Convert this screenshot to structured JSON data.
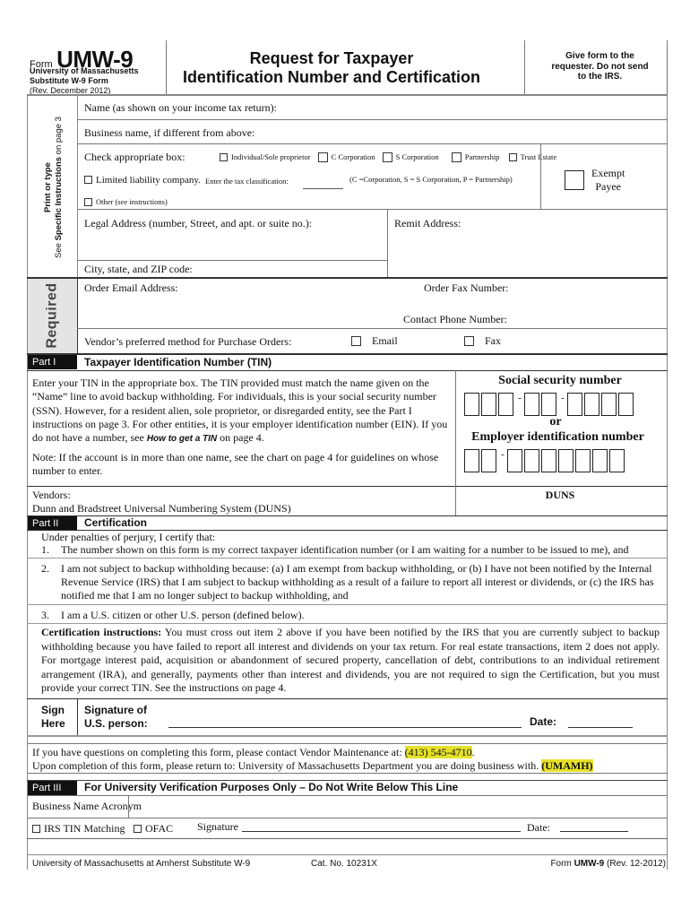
{
  "header": {
    "form_word": "Form",
    "form_code": "UMW-9",
    "org_line1": "University of Massachusetts",
    "org_line2": "Substitute W-9 Form",
    "revision": "(Rev. December 2012)",
    "title_line1": "Request for Taxpayer",
    "title_line2": "Identification Number and Certification",
    "notice": "Give form to the requester.  Do not send to the IRS."
  },
  "side_labels": {
    "print_or_type": "Print or type",
    "see_instructions_pre": "See ",
    "see_instructions_bold": "Specific Instructions",
    "see_instructions_post": " on page 3",
    "required": "Required"
  },
  "identity": {
    "name_label": "Name (as shown on your income tax return):",
    "business_name_label": "Business name, if different from above:",
    "check_box_label": "Check appropriate box:",
    "classifications": [
      "Individual/Sole proprietor",
      "C Corporation",
      "S Corporation",
      "Partnership",
      "Trust Estate"
    ],
    "llc_label": "Limited liability company.",
    "tax_class_label": "Enter the tax classification:",
    "tax_class_legend": "(C =Corporation, S = S Corporation, P = Partnership)",
    "other_label": "Other (see instructions)",
    "exempt_payee_line1": "Exempt",
    "exempt_payee_line2": "Payee",
    "legal_address_label": "Legal Address (number, Street, and apt. or suite no.):",
    "remit_address_label": "Remit Address:",
    "city_state_zip_label": "City, state, and ZIP code:"
  },
  "required_section": {
    "order_email_label": "Order Email Address:",
    "order_fax_label": "Order Fax Number:",
    "contact_phone_label": "Contact Phone Number:",
    "preferred_method_label": "Vendor’s preferred method for Purchase Orders:",
    "option_email": "Email",
    "option_fax": "Fax"
  },
  "part1": {
    "part_label": "Part I",
    "title": "Taxpayer Identification Number (TIN)",
    "instructions_pre": "Enter your TIN in the appropriate box.  The TIN provided must match the name given on the “Name” line to avoid backup withholding.  For individuals, this is your social security number (SSN).  However, for a resident alien, sole proprietor, or disregarded entity, see the Part I instructions on page 3.  For other entities, it is your employer identification number (EIN).  If you do not have a number, see ",
    "instructions_link": "How to get a TIN",
    "instructions_post": " on page 4.",
    "note": "Note: If the account is in more than one name, see the chart on page 4 for guidelines on whose number to enter.",
    "ssn_label": "Social security number",
    "or_label": "or",
    "ein_label": "Employer identification number",
    "vendors_label": "Vendors:",
    "duns_full": "Dunn and Bradstreet Universal Numbering System (DUNS)",
    "duns_label": "DUNS"
  },
  "part2": {
    "part_label": "Part II",
    "title": "Certification",
    "intro": "Under penalties of perjury, I certify that:",
    "items": [
      {
        "num": "1.",
        "text": "The number shown on this form is my correct taxpayer identification number (or I am waiting for a number to be issued to me), and"
      },
      {
        "num": "2.",
        "text": "I am not subject to backup withholding because: (a) I am exempt from backup withholding, or (b) I have not been notified by the Internal Revenue Service (IRS) that I am subject to backup withholding as a result of a failure to report all interest or dividends, or (c) the IRS has notified me that I am no longer subject to backup withholding, and"
      },
      {
        "num": "3.",
        "text": "I am a U.S. citizen or other U.S. person (defined below)."
      }
    ],
    "cert_instr_bold": "Certification instructions:",
    "cert_instr_text": "  You must cross out item 2 above if you have been notified by the IRS that you are currently subject to backup withholding because you have failed to report all interest and dividends on your tax return.  For real estate transactions, item 2 does not apply.  For mortgage interest paid, acquisition or abandonment of secured property, cancellation of debt, contributions to an individual retirement arrangement (IRA), and generally, payments other than interest and dividends, you are not required to sign the Certification, but you must provide your correct TIN.  See the instructions on page 4."
  },
  "sign": {
    "sign_here_line1": "Sign",
    "sign_here_line2": "Here",
    "signature_line1": "Signature of",
    "signature_line2": "U.S. person:",
    "date_label": "Date:"
  },
  "contact": {
    "questions_text": "If you have questions on completing this form, please contact Vendor Maintenance at: ",
    "phone": "(413) 545-4710",
    "phone_suffix": ".",
    "return_text": "Upon completion of this form, please return to: University of Massachusetts Department you are doing business with.  ",
    "dept_code": "(UMAMH)",
    "highlight_color": "#e6e22a"
  },
  "part3": {
    "part_label": "Part III",
    "title": "For University Verification Purposes Only – Do Not Write Below This Line",
    "business_acronym_label": "Business Name Acronym",
    "irs_tin_label": "IRS TIN Matching",
    "ofac_label": "OFAC",
    "signature_label": "Signature",
    "date_label": "Date:"
  },
  "footer": {
    "left": "University of Massachusetts at Amherst Substitute W-9",
    "center": "Cat. No. 10231X",
    "right_pre": "Form ",
    "right_bold": "UMW-9",
    "right_post": " (Rev. 12-2012)"
  }
}
